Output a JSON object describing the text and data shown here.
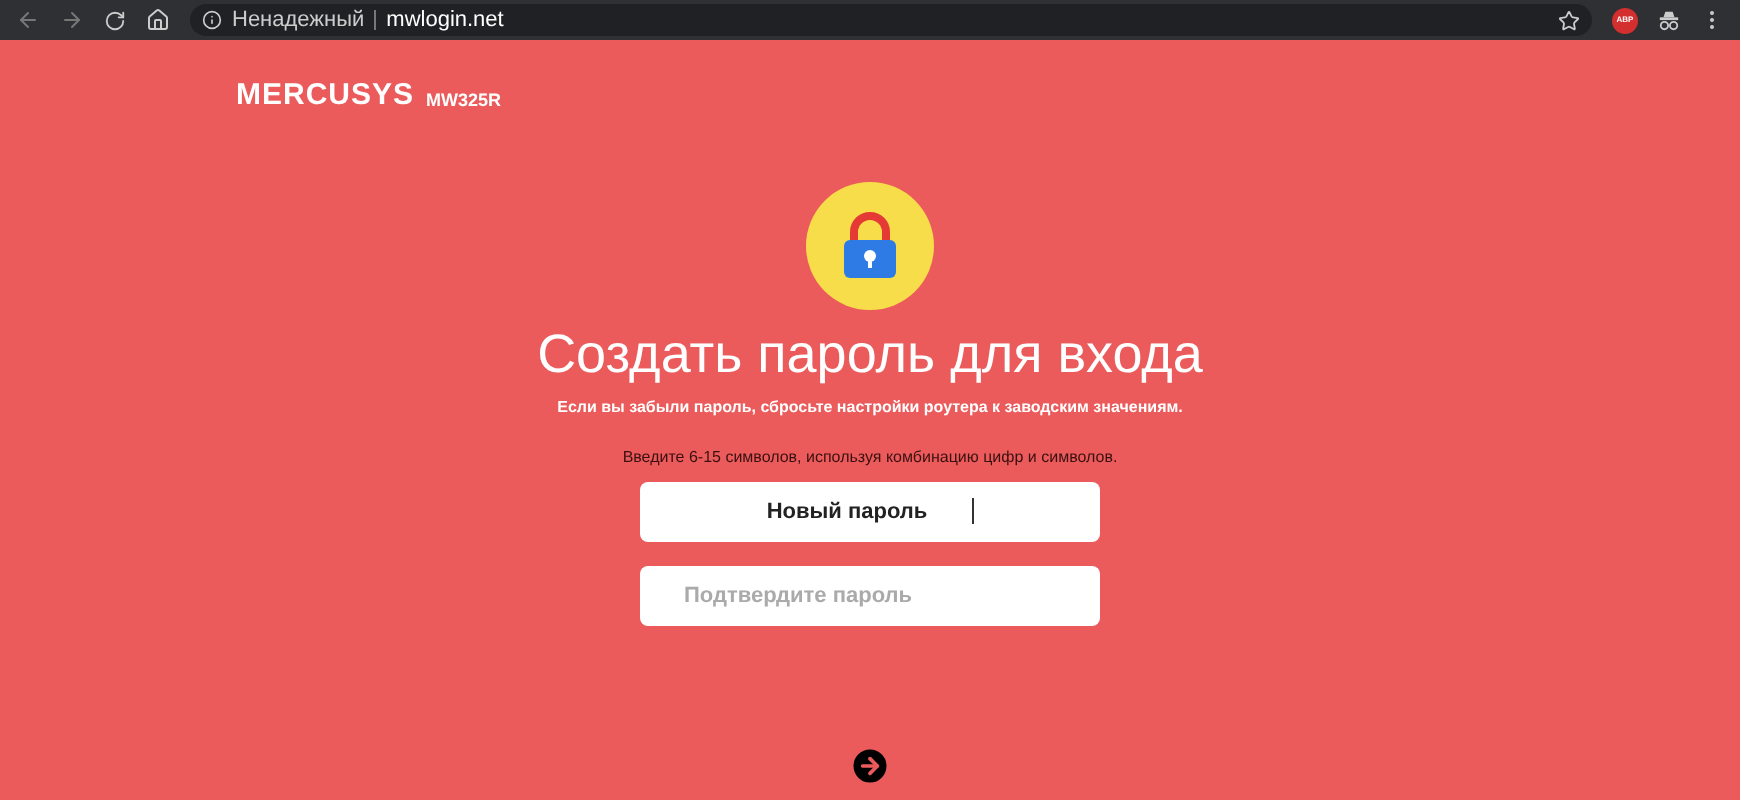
{
  "browser": {
    "security_label": "Ненадежный",
    "url": "mwlogin.net",
    "extension_badge": "ABP"
  },
  "header": {
    "brand": "MERCUSYS",
    "model": "MW325R"
  },
  "title": "Создать пароль для входа",
  "notice": "Если вы забыли пароль, сбросьте настройки роутера к заводским значениям.",
  "hint": "Введите 6-15 символов, используя комбинацию цифр и символов.",
  "fields": [
    {
      "kind": "label",
      "label": "Новый пароль",
      "focused": true
    },
    {
      "kind": "input",
      "placeholder": "Подтвердите пароль",
      "focused": false
    }
  ]
}
